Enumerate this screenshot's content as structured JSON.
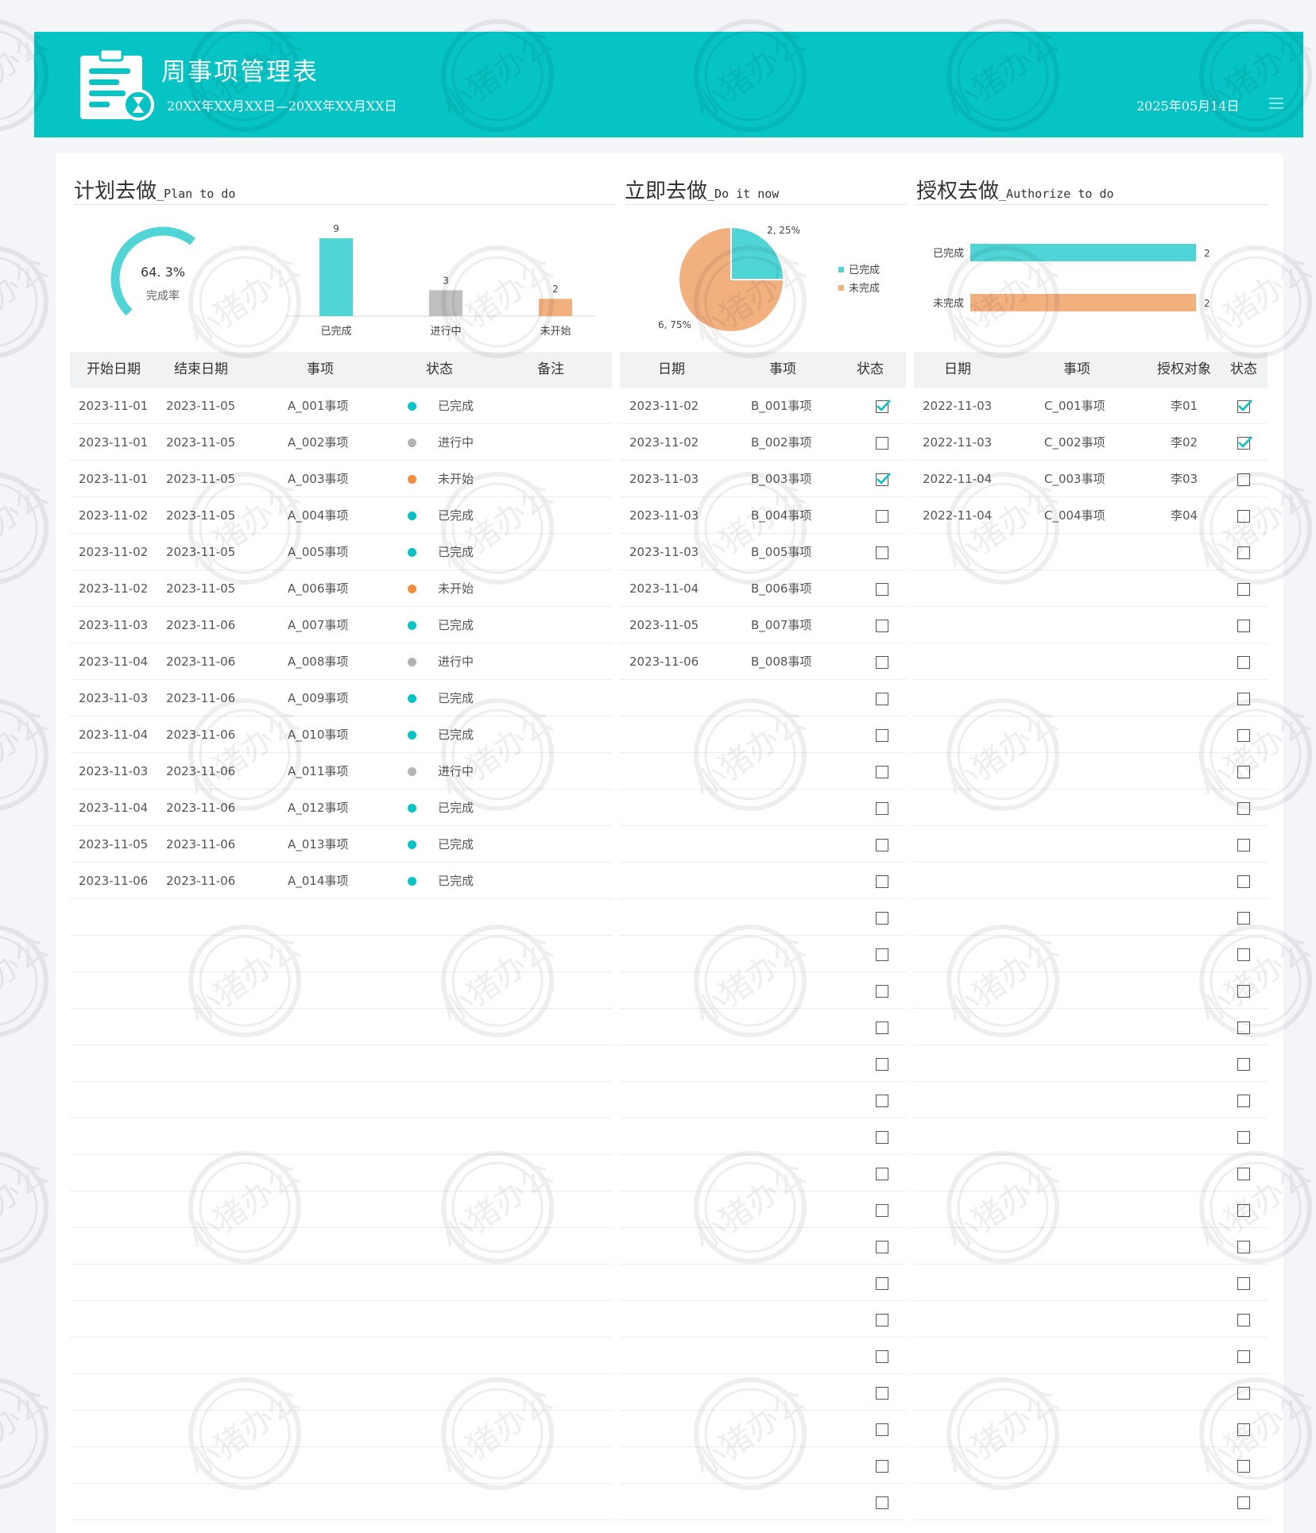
{
  "header": {
    "title": "周事项管理表",
    "date_range": "20XX年XX月XX日—20XX年XX月XX日",
    "today": "2025年05月14日"
  },
  "colors": {
    "teal": "#06c4c3",
    "bar_teal": "#4fd5d6",
    "grey": "#b3b3b3",
    "orange": "#f48b3e",
    "salmon": "#f3b07f"
  },
  "plan": {
    "title_cn": "计划去做",
    "title_en": "_Plan to do",
    "gauge": {
      "value": "64. 3%",
      "label": "完成率",
      "fraction": 0.643
    },
    "headers": [
      "开始日期",
      "结束日期",
      "事项",
      "状态",
      "备注"
    ],
    "rows": [
      {
        "start": "2023-11-01",
        "end": "2023-11-05",
        "item": "A_001事项",
        "status": "已完成",
        "tone": "done"
      },
      {
        "start": "2023-11-01",
        "end": "2023-11-05",
        "item": "A_002事项",
        "status": "进行中",
        "tone": "progress"
      },
      {
        "start": "2023-11-01",
        "end": "2023-11-05",
        "item": "A_003事项",
        "status": "未开始",
        "tone": "todo"
      },
      {
        "start": "2023-11-02",
        "end": "2023-11-05",
        "item": "A_004事项",
        "status": "已完成",
        "tone": "done"
      },
      {
        "start": "2023-11-02",
        "end": "2023-11-05",
        "item": "A_005事项",
        "status": "已完成",
        "tone": "done"
      },
      {
        "start": "2023-11-02",
        "end": "2023-11-05",
        "item": "A_006事项",
        "status": "未开始",
        "tone": "todo"
      },
      {
        "start": "2023-11-03",
        "end": "2023-11-06",
        "item": "A_007事项",
        "status": "已完成",
        "tone": "done"
      },
      {
        "start": "2023-11-04",
        "end": "2023-11-06",
        "item": "A_008事项",
        "status": "进行中",
        "tone": "progress"
      },
      {
        "start": "2023-11-03",
        "end": "2023-11-06",
        "item": "A_009事项",
        "status": "已完成",
        "tone": "done"
      },
      {
        "start": "2023-11-04",
        "end": "2023-11-06",
        "item": "A_010事项",
        "status": "已完成",
        "tone": "done"
      },
      {
        "start": "2023-11-03",
        "end": "2023-11-06",
        "item": "A_011事项",
        "status": "进行中",
        "tone": "progress"
      },
      {
        "start": "2023-11-04",
        "end": "2023-11-06",
        "item": "A_012事项",
        "status": "已完成",
        "tone": "done"
      },
      {
        "start": "2023-11-05",
        "end": "2023-11-06",
        "item": "A_013事项",
        "status": "已完成",
        "tone": "done"
      },
      {
        "start": "2023-11-06",
        "end": "2023-11-06",
        "item": "A_014事项",
        "status": "已完成",
        "tone": "done"
      }
    ]
  },
  "now": {
    "title_cn": "立即去做",
    "title_en": "_Do it now",
    "headers": [
      "日期",
      "事项",
      "状态"
    ],
    "rows": [
      {
        "date": "2023-11-02",
        "item": "B_001事项",
        "checked": true
      },
      {
        "date": "2023-11-02",
        "item": "B_002事项",
        "checked": false
      },
      {
        "date": "2023-11-03",
        "item": "B_003事项",
        "checked": true
      },
      {
        "date": "2023-11-03",
        "item": "B_004事项",
        "checked": false
      },
      {
        "date": "2023-11-03",
        "item": "B_005事项",
        "checked": false
      },
      {
        "date": "2023-11-04",
        "item": "B_006事项",
        "checked": false
      },
      {
        "date": "2023-11-05",
        "item": "B_007事项",
        "checked": false
      },
      {
        "date": "2023-11-06",
        "item": "B_008事项",
        "checked": false
      }
    ]
  },
  "auth": {
    "title_cn": "授权去做",
    "title_en": "_Authorize to do",
    "headers": [
      "日期",
      "事项",
      "授权对象",
      "状态"
    ],
    "rows": [
      {
        "date": "2022-11-03",
        "item": "C_001事项",
        "person": "李01",
        "checked": true
      },
      {
        "date": "2022-11-03",
        "item": "C_002事项",
        "person": "李02",
        "checked": true
      },
      {
        "date": "2022-11-04",
        "item": "C_003事项",
        "person": "李03",
        "checked": false
      },
      {
        "date": "2022-11-04",
        "item": "C_004事项",
        "person": "李04",
        "checked": false
      }
    ]
  },
  "chart_data": [
    {
      "type": "bar",
      "categories": [
        "已完成",
        "进行中",
        "未开始"
      ],
      "values": [
        9,
        3,
        2
      ],
      "colors": [
        "#4fd5d6",
        "#bfbfbf",
        "#f3b07f"
      ]
    },
    {
      "type": "pie",
      "labels": [
        "已完成",
        "未完成"
      ],
      "values": [
        2,
        6
      ],
      "data_labels": [
        "2, 25%",
        "6, 75%"
      ],
      "percent": [
        25,
        75
      ],
      "colors": [
        "#4fd5d6",
        "#f3b07f"
      ],
      "legend": "right"
    },
    {
      "type": "bar",
      "orientation": "horizontal",
      "categories": [
        "已完成",
        "未完成"
      ],
      "values": [
        2,
        2
      ],
      "colors": [
        "#4fd5d6",
        "#f3b07f"
      ]
    }
  ],
  "watermark": "小猪办公"
}
